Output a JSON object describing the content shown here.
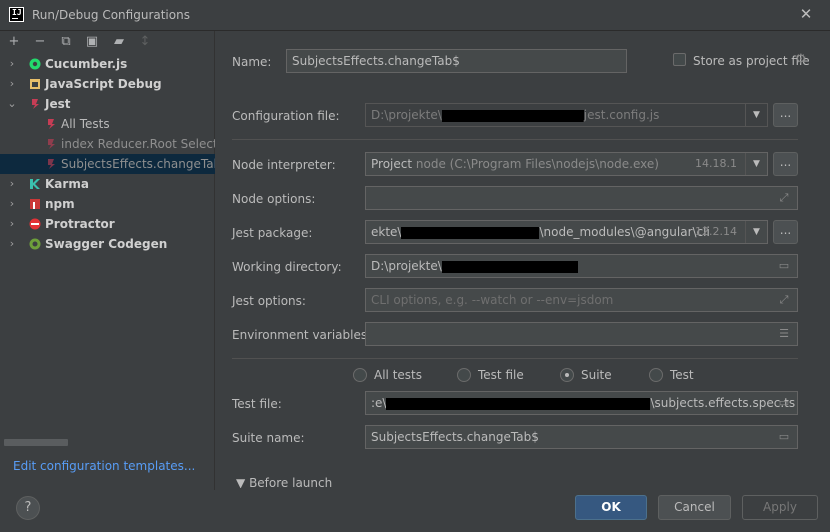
{
  "window": {
    "title": "Run/Debug Configurations"
  },
  "toolbar": {
    "icons": [
      "add-icon",
      "remove-icon",
      "copy-icon",
      "save-icon",
      "folder-add-icon",
      "sort-icon"
    ],
    "add": "+",
    "remove": "−",
    "copy": "⧉",
    "save": "▣",
    "folder": "▰",
    "sort": "↕"
  },
  "tree": {
    "items": [
      {
        "label": "Cucumber.js",
        "icon": "cucumber-icon",
        "color": "#23d96c"
      },
      {
        "label": "JavaScript Debug",
        "icon": "js-debug-icon",
        "color": "#e8bf6a"
      },
      {
        "label": "Jest",
        "icon": "jest-icon",
        "color": "#c63d55"
      },
      {
        "label": "All Tests",
        "icon": "jest-icon",
        "color": "#c63d55"
      },
      {
        "label": "index Reducer.Root Selectors",
        "icon": "jest-icon",
        "color": "#c63d55"
      },
      {
        "label": "SubjectsEffects.changeTab$",
        "icon": "jest-icon",
        "color": "#c63d55"
      },
      {
        "label": "Karma",
        "icon": "karma-icon",
        "color": "#3ac1ae"
      },
      {
        "label": "npm",
        "icon": "npm-icon",
        "color": "#cb3837"
      },
      {
        "label": "Protractor",
        "icon": "protractor-icon",
        "color": "#e23237"
      },
      {
        "label": "Swagger Codegen",
        "icon": "swagger-icon",
        "color": "#6d9f3b"
      }
    ]
  },
  "edit_templates": "Edit configuration templates...",
  "form": {
    "name_label": "Name:",
    "name_value": "SubjectsEffects.changeTab$",
    "store_label": "Store as project file",
    "config_label": "Configuration file:",
    "config_prefix": "D:\\projekte\\",
    "config_suffix": "jest.config.js",
    "node_interp_label": "Node interpreter:",
    "node_interp_project": "Project",
    "node_interp_path": "node (C:\\Program Files\\nodejs\\node.exe)",
    "node_interp_version": "14.18.1",
    "node_options_label": "Node options:",
    "jest_pkg_label": "Jest package:",
    "jest_pkg_prefix": "ekte\\",
    "jest_pkg_suffix": "\\node_modules\\@angular\\cli",
    "jest_pkg_version": "12.2.14",
    "working_dir_label": "Working directory:",
    "working_dir_prefix": "D:\\projekte\\",
    "jest_options_label": "Jest options:",
    "jest_options_placeholder": "CLI options, e.g. --watch or --env=jsdom",
    "env_vars_label": "Environment variables:",
    "radio_all": "All tests",
    "radio_file": "Test file",
    "radio_suite": "Suite",
    "radio_test": "Test",
    "selected_scope": "Suite",
    "test_file_label": "Test file:",
    "test_file_prefix": ":e\\",
    "test_file_suffix": "\\subjects.effects.spec.ts",
    "suite_name_label": "Suite name:",
    "suite_name_value": "SubjectsEffects.changeTab$",
    "before_launch": "Before launch"
  },
  "buttons": {
    "help": "?",
    "ok": "OK",
    "cancel": "Cancel",
    "apply": "Apply"
  },
  "colors": {
    "accent": "#365880",
    "link": "#589df6",
    "selection": "#0d293e"
  }
}
